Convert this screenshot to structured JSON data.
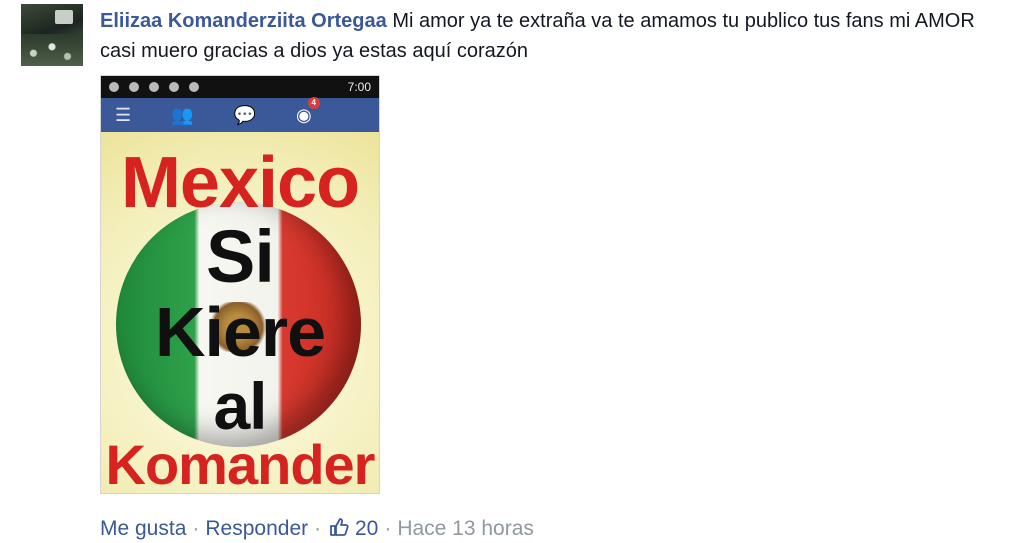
{
  "comment": {
    "author": "Eliizaa Komanderziita Ortegaa",
    "text": "Mi amor ya te extraña va te amamos tu publico tus fans mi AMOR casi muero gracias a dios ya estas aquí corazón"
  },
  "photo": {
    "status_time": "7:00",
    "notification_count": "4",
    "poster_lines": [
      "Mexico",
      "Si",
      "Kiere",
      "al",
      "Komander"
    ]
  },
  "actions": {
    "like": "Me gusta",
    "reply": "Responder",
    "like_count": "20",
    "time": "Hace 13 horas"
  },
  "colors": {
    "link": "#3b5998",
    "muted": "#9197a3",
    "navbar": "#3b5998"
  },
  "icons": {
    "like_count_icon": "thumbs-up-icon",
    "menu": "hamburger-menu-icon",
    "friends": "friends-icon",
    "messages": "messages-icon",
    "notifications": "globe-icon"
  }
}
